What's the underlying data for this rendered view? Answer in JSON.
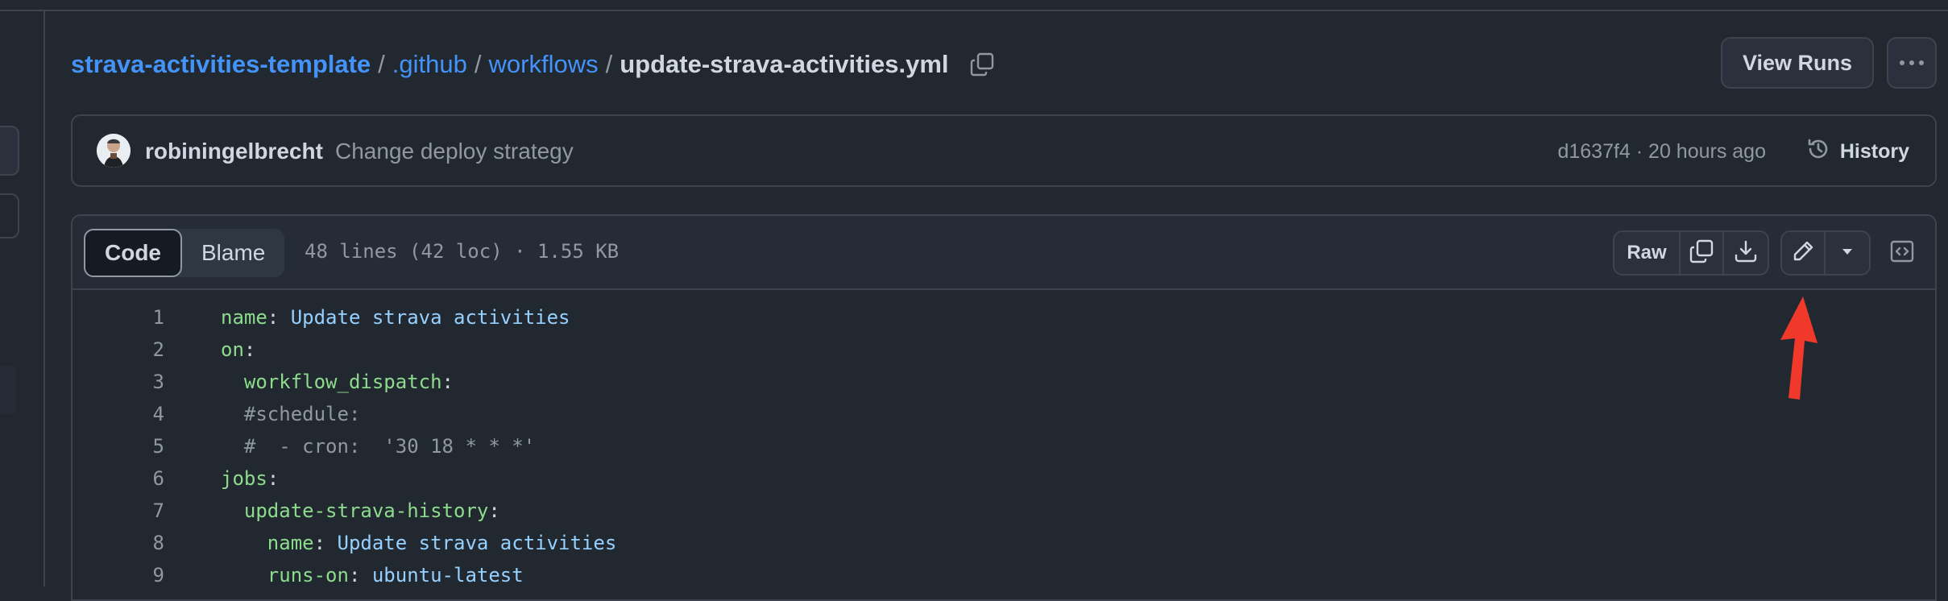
{
  "breadcrumb": {
    "repo": "strava-activities-template",
    "sep1": "/",
    "dir1": ".github",
    "sep2": "/",
    "dir2": "workflows",
    "sep3": "/",
    "file": "update-strava-activities.yml"
  },
  "header_actions": {
    "view_runs": "View Runs"
  },
  "commit": {
    "author": "robiningelbrecht",
    "message": "Change deploy strategy",
    "meta": "d1637f4 · 20 hours ago",
    "history_label": "History"
  },
  "file_header": {
    "tab_code": "Code",
    "tab_blame": "Blame",
    "stats": "48 lines (42 loc) · 1.55 KB",
    "raw_label": "Raw"
  },
  "code_lines": [
    {
      "num": "1",
      "indent": "",
      "key": "name",
      "punct": ": ",
      "value": "Update strava activities",
      "comment": ""
    },
    {
      "num": "2",
      "indent": "",
      "key": "on",
      "punct": ":",
      "value": "",
      "comment": ""
    },
    {
      "num": "3",
      "indent": "  ",
      "key": "workflow_dispatch",
      "punct": ":",
      "value": "",
      "comment": ""
    },
    {
      "num": "4",
      "indent": "  ",
      "key": "",
      "punct": "",
      "value": "",
      "comment": "#schedule:"
    },
    {
      "num": "5",
      "indent": "  ",
      "key": "",
      "punct": "",
      "value": "",
      "comment": "#  - cron:  '30 18 * * *'"
    },
    {
      "num": "6",
      "indent": "",
      "key": "jobs",
      "punct": ":",
      "value": "",
      "comment": ""
    },
    {
      "num": "7",
      "indent": "  ",
      "key": "update-strava-history",
      "punct": ":",
      "value": "",
      "comment": ""
    },
    {
      "num": "8",
      "indent": "    ",
      "key": "name",
      "punct": ": ",
      "value": "Update strava activities",
      "comment": ""
    },
    {
      "num": "9",
      "indent": "    ",
      "key": "runs-on",
      "punct": ": ",
      "value": "ubuntu-latest",
      "comment": ""
    }
  ],
  "colors": {
    "background": "#212830",
    "link": "#4493f8",
    "annotation_arrow": "#f0392b"
  }
}
